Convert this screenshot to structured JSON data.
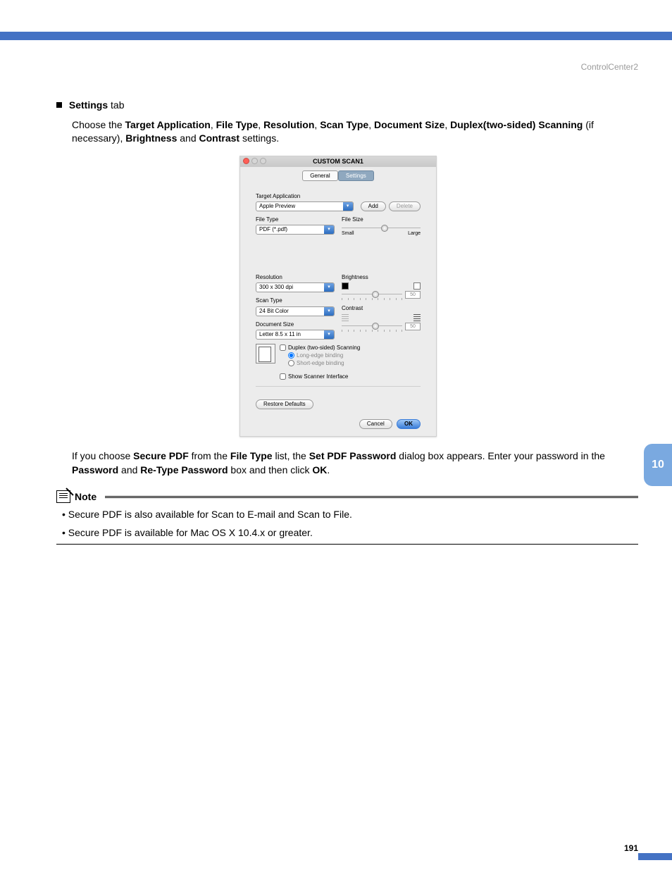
{
  "header": {
    "breadcrumb": "ControlCenter2"
  },
  "page": {
    "number": "191",
    "side_tab": "10"
  },
  "heading": {
    "label": "Settings",
    "suffix": " tab"
  },
  "intro": {
    "pieces": [
      {
        "t": "Choose the "
      },
      {
        "t": "Target Application",
        "b": true
      },
      {
        "t": ", "
      },
      {
        "t": "File Type",
        "b": true
      },
      {
        "t": ", "
      },
      {
        "t": "Resolution",
        "b": true
      },
      {
        "t": ", "
      },
      {
        "t": "Scan Type",
        "b": true
      },
      {
        "t": ", "
      },
      {
        "t": "Document Size",
        "b": true
      },
      {
        "t": ", "
      },
      {
        "t": "Duplex(two-sided) Scanning",
        "b": true
      },
      {
        "t": " (if necessary), "
      },
      {
        "t": "Brightness",
        "b": true
      },
      {
        "t": " and "
      },
      {
        "t": "Contrast",
        "b": true
      },
      {
        "t": " settings."
      }
    ]
  },
  "after": {
    "pieces": [
      {
        "t": "If you choose "
      },
      {
        "t": "Secure PDF",
        "b": true
      },
      {
        "t": " from the "
      },
      {
        "t": "File Type",
        "b": true
      },
      {
        "t": " list, the "
      },
      {
        "t": "Set PDF Password",
        "b": true
      },
      {
        "t": " dialog box appears. Enter your password in the "
      },
      {
        "t": "Password",
        "b": true
      },
      {
        "t": " and "
      },
      {
        "t": "Re-Type Password",
        "b": true
      },
      {
        "t": " box and then click "
      },
      {
        "t": "OK",
        "b": true
      },
      {
        "t": "."
      }
    ]
  },
  "note": {
    "title": "Note",
    "items": [
      "Secure PDF is also available for Scan to E-mail and Scan to File.",
      "Secure PDF is available for Mac OS X 10.4.x or greater."
    ]
  },
  "dialog": {
    "title": "CUSTOM SCAN1",
    "tabs": {
      "general": "General",
      "settings": "Settings"
    },
    "target_app_label": "Target Application",
    "target_app_value": "Apple Preview",
    "add_btn": "Add",
    "delete_btn": "Delete",
    "file_type_label": "File Type",
    "file_type_value": "PDF (*.pdf)",
    "file_size_label": "File Size",
    "file_size_small": "Small",
    "file_size_large": "Large",
    "resolution_label": "Resolution",
    "resolution_value": "300 x 300 dpi",
    "scan_type_label": "Scan Type",
    "scan_type_value": "24 Bit Color",
    "doc_size_label": "Document Size",
    "doc_size_value": "Letter  8.5 x 11 in",
    "brightness_label": "Brightness",
    "brightness_value": "50",
    "contrast_label": "Contrast",
    "contrast_value": "50",
    "duplex_label": "Duplex (two-sided) Scanning",
    "long_edge": "Long-edge binding",
    "short_edge": "Short-edge binding",
    "show_scanner": "Show Scanner Interface",
    "restore_defaults": "Restore Defaults",
    "cancel": "Cancel",
    "ok": "OK"
  }
}
